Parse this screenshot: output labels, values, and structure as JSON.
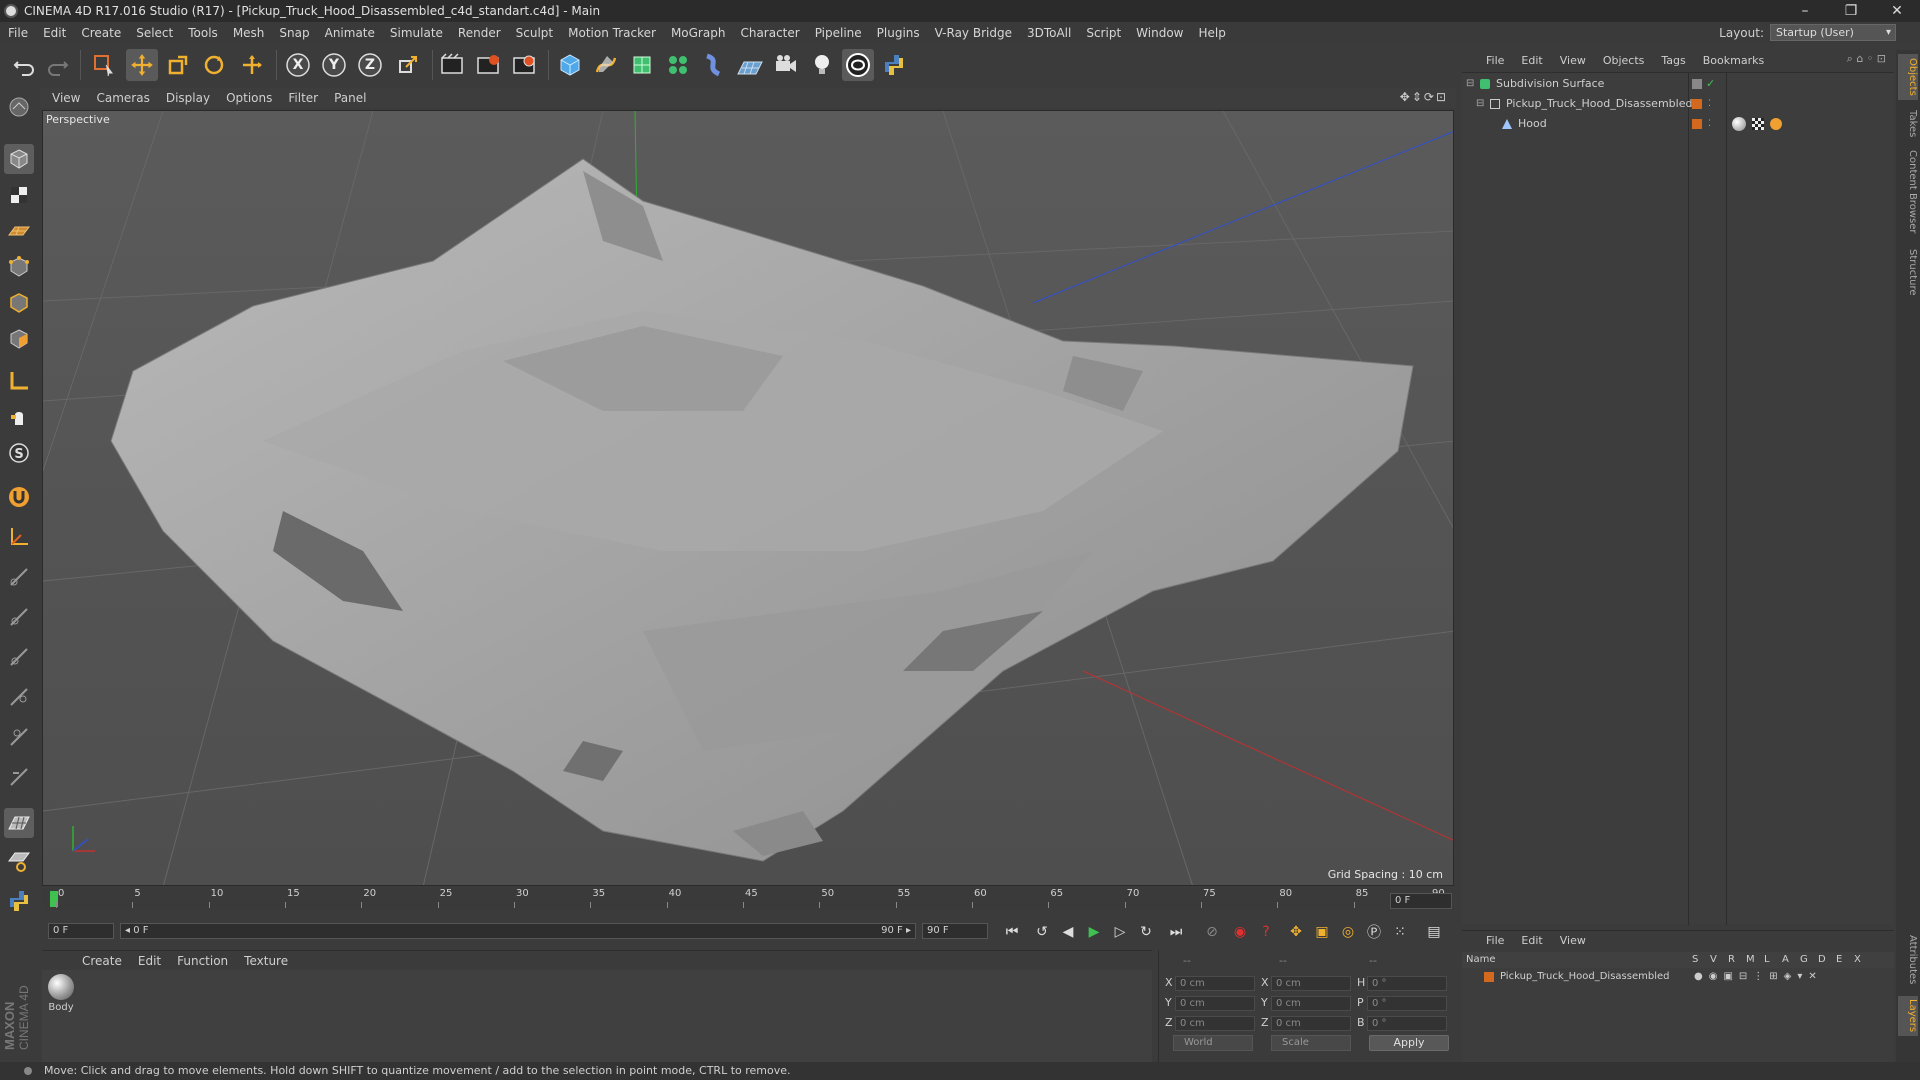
{
  "window": {
    "title": "CINEMA 4D R17.016 Studio (R17) - [Pickup_Truck_Hood_Disassembled_c4d_standart.c4d] - Main",
    "controls": [
      "–",
      "❐",
      "✕"
    ]
  },
  "menubar": {
    "items": [
      "File",
      "Edit",
      "Create",
      "Select",
      "Tools",
      "Mesh",
      "Snap",
      "Animate",
      "Simulate",
      "Render",
      "Sculpt",
      "Motion Tracker",
      "MoGraph",
      "Character",
      "Pipeline",
      "Plugins",
      "V-Ray Bridge",
      "3DToAll",
      "Script",
      "Window",
      "Help"
    ],
    "layout_label": "Layout:",
    "layout_value": "Startup (User)"
  },
  "toolbar": {
    "x_label": "X",
    "y_label": "Y",
    "z_label": "Z"
  },
  "viewport": {
    "menu": [
      "View",
      "Cameras",
      "Display",
      "Options",
      "Filter",
      "Panel"
    ],
    "camera_label": "Perspective",
    "grid_spacing": "Grid Spacing : 10 cm",
    "nav_icons": "✥⇕⟳⊡"
  },
  "timeline": {
    "ticks": [
      "0",
      "5",
      "10",
      "15",
      "20",
      "25",
      "30",
      "35",
      "40",
      "45",
      "50",
      "55",
      "60",
      "65",
      "70",
      "75",
      "80",
      "85",
      "90"
    ],
    "current_frame_display": "0 F"
  },
  "transport": {
    "start_field": "0 F",
    "range_start": "◂ 0 F",
    "range_end": "90 F ▸",
    "end_field": "90 F"
  },
  "material_manager": {
    "menu": [
      "Create",
      "Edit",
      "Function",
      "Texture"
    ],
    "materials": [
      {
        "name": "Body"
      }
    ]
  },
  "coordinates": {
    "header": [
      "--",
      "--",
      "--"
    ],
    "rows": [
      {
        "a": "X",
        "av": "0 cm",
        "b": "X",
        "bv": "0 cm",
        "c": "H",
        "cv": "0 °"
      },
      {
        "a": "Y",
        "av": "0 cm",
        "b": "Y",
        "bv": "0 cm",
        "c": "P",
        "cv": "0 °"
      },
      {
        "a": "Z",
        "av": "0 cm",
        "b": "Z",
        "bv": "0 cm",
        "c": "B",
        "cv": "0 °"
      }
    ],
    "world_dropdown": "World",
    "scale_dropdown": "Scale",
    "apply_label": "Apply"
  },
  "status": {
    "message": "Move: Click and drag to move elements. Hold down SHIFT to quantize movement / add to the selection in point mode, CTRL to remove."
  },
  "object_manager": {
    "menu": [
      "File",
      "Edit",
      "View",
      "Objects",
      "Tags",
      "Bookmarks"
    ],
    "objects": [
      {
        "name": "Subdivision Surface",
        "color": "#6fcf6f"
      },
      {
        "name": "Pickup_Truck_Hood_Disassembled",
        "color": "#d0d0d0"
      },
      {
        "name": "Hood",
        "color": "#9ec7ff"
      }
    ]
  },
  "layer_manager": {
    "menu": [
      "File",
      "Edit",
      "View"
    ],
    "columns": [
      "Name",
      "S",
      "V",
      "R",
      "M",
      "L",
      "A",
      "G",
      "D",
      "E",
      "X"
    ],
    "layers": [
      {
        "name": "Pickup_Truck_Hood_Disassembled",
        "color": "#d2691e"
      }
    ]
  },
  "side_tabs": [
    "Objects",
    "Takes",
    "Content Browser",
    "Structure",
    "Attributes",
    "Layers"
  ],
  "colors": {
    "accent": "#f0b030",
    "axis_x": "#c03030",
    "axis_y": "#30b030",
    "axis_z": "#3050d0",
    "layer_orange": "#d2691e"
  }
}
